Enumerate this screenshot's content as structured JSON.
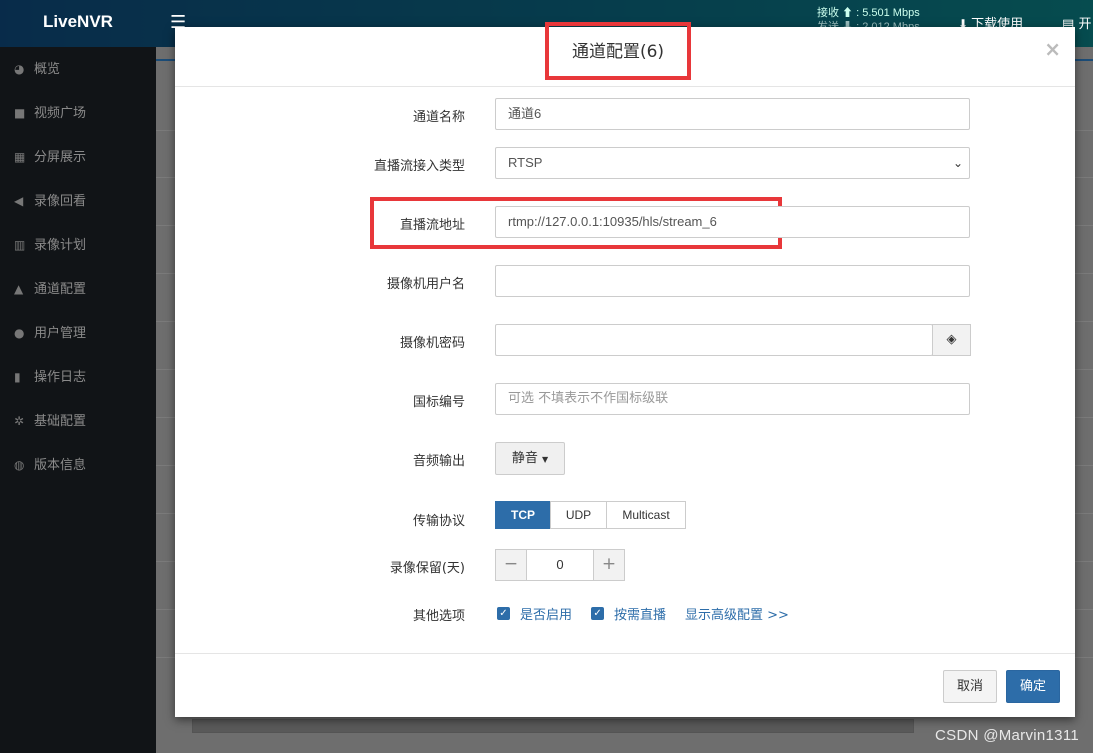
{
  "app": {
    "brand": "LiveNVR",
    "menu_icon": "hamburger-icon",
    "net_stats": {
      "line1": "接收 ⬆ : 5.501 Mbps",
      "line2": "发送 ⬇ : 2.012 Mbps"
    },
    "download_label": "下载使用",
    "open_label": "开"
  },
  "sidebar": {
    "items": [
      {
        "label": "概览",
        "icon": "dashboard-icon"
      },
      {
        "label": "视频广场",
        "icon": "video-camera-icon"
      },
      {
        "label": "分屏展示",
        "icon": "grid-icon"
      },
      {
        "label": "录像回看",
        "icon": "rewind-icon"
      },
      {
        "label": "录像计划",
        "icon": "calendar-icon"
      },
      {
        "label": "通道配置",
        "icon": "road-icon"
      },
      {
        "label": "用户管理",
        "icon": "users-icon"
      },
      {
        "label": "操作日志",
        "icon": "file-icon"
      },
      {
        "label": "基础配置",
        "icon": "cogs-icon"
      },
      {
        "label": "版本信息",
        "icon": "globe-icon"
      }
    ]
  },
  "modal": {
    "title": "通道配置(6)",
    "close_label": "×",
    "fields": {
      "channel_name": {
        "label": "通道名称",
        "value": "通道6"
      },
      "stream_type": {
        "label": "直播流接入类型",
        "value": "RTSP"
      },
      "stream_url": {
        "label": "直播流地址",
        "value": "rtmp://127.0.0.1:10935/hls/stream_6"
      },
      "camera_user": {
        "label": "摄像机用户名",
        "value": ""
      },
      "camera_password": {
        "label": "摄像机密码",
        "value": ""
      },
      "gb_code": {
        "label": "国标编号",
        "placeholder": "可选 不填表示不作国标级联"
      },
      "audio_output": {
        "label": "音频输出",
        "value": "静音"
      },
      "transport": {
        "label": "传输协议",
        "options": [
          "TCP",
          "UDP",
          "Multicast"
        ],
        "selected": "TCP"
      },
      "record_keep": {
        "label": "录像保留(天)",
        "value": "0",
        "minus": "−",
        "plus": "+"
      },
      "other": {
        "label": "其他选项",
        "enable_label": "是否启用",
        "enable_checked": true,
        "on_demand_label": "按需直播",
        "on_demand_checked": true,
        "advanced_link": "显示高级配置 >>"
      }
    },
    "cancel_label": "取消",
    "ok_label": "确定"
  },
  "watermark": "CSDN @Marvin1311",
  "colors": {
    "primary": "#2d6da9",
    "highlight": "#e8373a",
    "sidebar_bg": "#111417"
  }
}
